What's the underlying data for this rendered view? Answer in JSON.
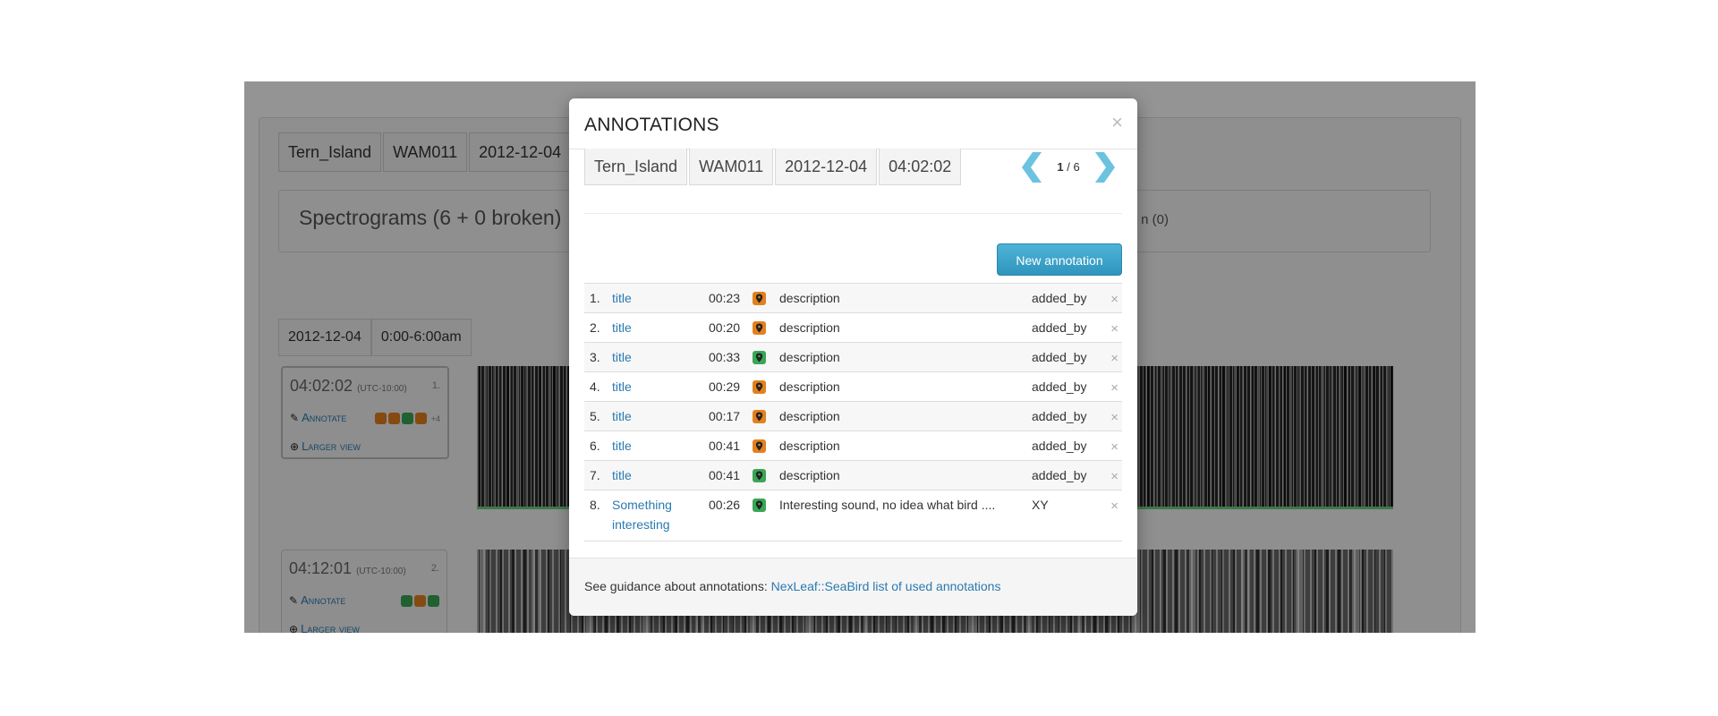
{
  "background": {
    "crumbs": [
      "Tern_Island",
      "WAM011",
      "2012-12-04"
    ],
    "spectrograms_title": "Spectrograms (6 + 0 broken)",
    "spectrograms_side_text": "n (0)",
    "day": "2012-12-04",
    "day_range": "0:00-6:00am",
    "items": [
      {
        "time": "04:02:02",
        "tz": "(UTC-10:00)",
        "index": "1.",
        "annotate_label": "Annotate",
        "larger_label": "Larger view",
        "tag_colors": [
          "#e3801e",
          "#e3801e",
          "#3aa655",
          "#e3801e"
        ],
        "more": "+4"
      },
      {
        "time": "04:12:01",
        "tz": "(UTC-10:00)",
        "index": "2.",
        "annotate_label": "Annotate",
        "larger_label": "Larger view",
        "tag_colors": [
          "#3aa655",
          "#e3801e",
          "#3aa655"
        ],
        "more": ""
      }
    ]
  },
  "modal": {
    "title": "ANNOTATIONS",
    "close": "×",
    "crumbs": [
      "Tern_Island",
      "WAM011",
      "2012-12-04",
      "04:02:02"
    ],
    "pager": {
      "current": "1",
      "separator": "/",
      "total": "6"
    },
    "new_button": "New annotation",
    "rows": [
      {
        "num": "1.",
        "title": "title",
        "duration": "00:23",
        "tag_color": "#e3801e",
        "description": "description",
        "added_by": "added_by"
      },
      {
        "num": "2.",
        "title": "title",
        "duration": "00:20",
        "tag_color": "#e3801e",
        "description": "description",
        "added_by": "added_by"
      },
      {
        "num": "3.",
        "title": "title",
        "duration": "00:33",
        "tag_color": "#3aa655",
        "description": "description",
        "added_by": "added_by"
      },
      {
        "num": "4.",
        "title": "title",
        "duration": "00:29",
        "tag_color": "#e3801e",
        "description": "description",
        "added_by": "added_by"
      },
      {
        "num": "5.",
        "title": "title",
        "duration": "00:17",
        "tag_color": "#e3801e",
        "description": "description",
        "added_by": "added_by"
      },
      {
        "num": "6.",
        "title": "title",
        "duration": "00:41",
        "tag_color": "#e3801e",
        "description": "description",
        "added_by": "added_by"
      },
      {
        "num": "7.",
        "title": "title",
        "duration": "00:41",
        "tag_color": "#3aa655",
        "description": "description",
        "added_by": "added_by"
      },
      {
        "num": "8.",
        "title": "Something interesting",
        "duration": "00:26",
        "tag_color": "#3aa655",
        "description": "Interesting sound, no idea what bird ....",
        "added_by": "XY"
      }
    ],
    "delete_glyph": "×",
    "footer_text": "See guidance about annotations: ",
    "footer_link": "NexLeaf::SeaBird list of used annotations"
  },
  "colors": {
    "link": "#2a7ab0",
    "primary_button": "#2f95bd",
    "pager_arrow": "#6cc3e0",
    "tag_orange": "#e3801e",
    "tag_green": "#3aa655"
  }
}
